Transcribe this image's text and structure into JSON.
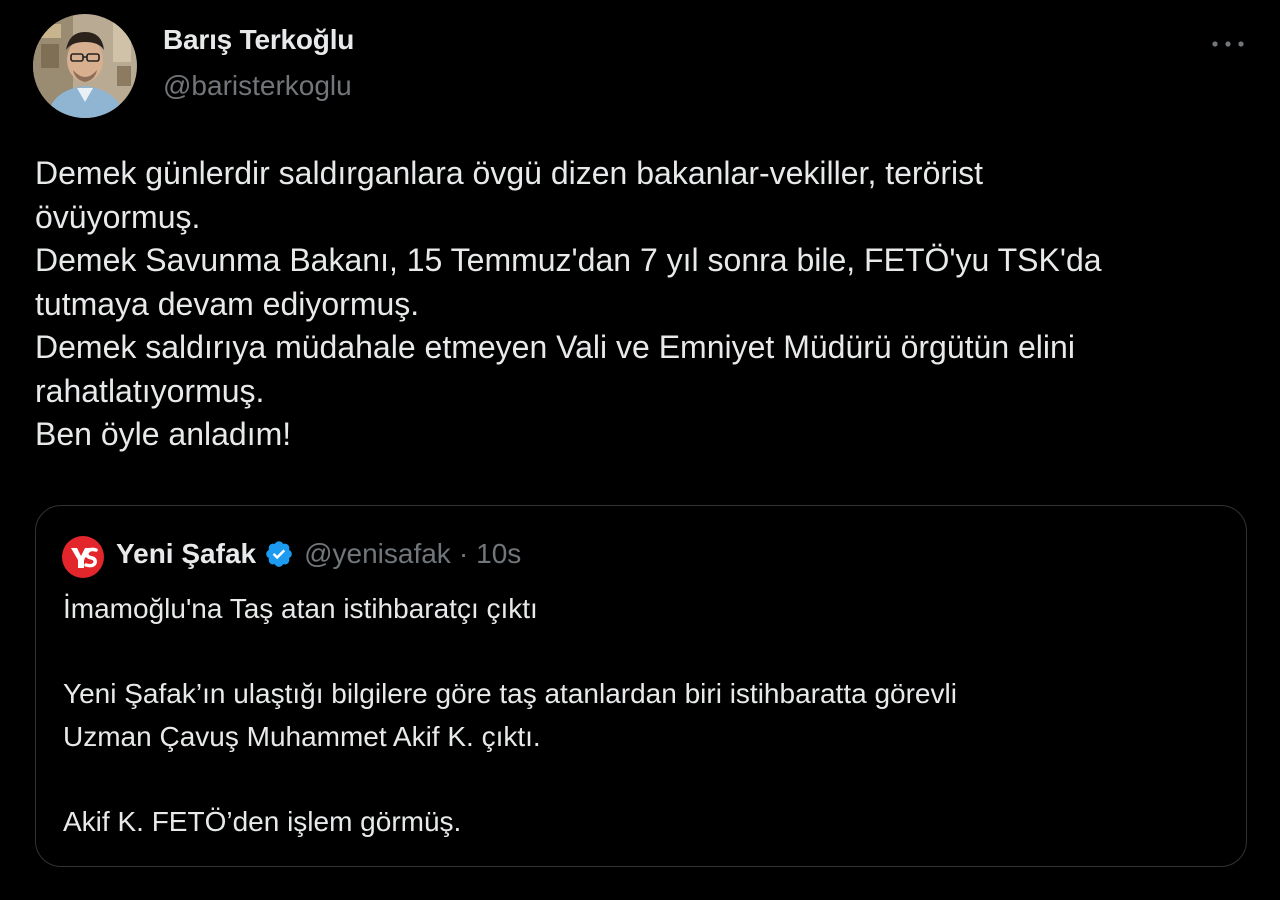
{
  "author": {
    "name": "Barış Terkoğlu",
    "handle": "@baristerkoglu"
  },
  "more_icon": "ellipsis-icon",
  "tweet_lines": [
    "Demek günlerdir saldırganlara övgü dizen bakanlar-vekiller, terörist",
    "övüyormuş.",
    "Demek Savunma Bakanı, 15 Temmuz'dan 7 yıl sonra bile, FETÖ'yu TSK'da",
    "tutmaya devam ediyormuş.",
    "Demek saldırıya müdahale etmeyen Vali ve Emniyet Müdürü örgütün elini",
    "rahatlatıyormuş.",
    "Ben öyle anladım!"
  ],
  "quoted": {
    "name": "Yeni Şafak",
    "verified_icon": "verified-badge-icon",
    "handle": "@yenisafak",
    "separator": "·",
    "time": "10s",
    "lines": [
      "İmamoğlu'na Taş atan istihbaratçı çıktı",
      "",
      "Yeni Şafak’ın ulaştığı bilgilere göre taş atanlardan biri istihbaratta görevli",
      "Uzman Çavuş Muhammet Akif K. çıktı.",
      "",
      "Akif K. FETÖ’den işlem görmüş."
    ]
  },
  "colors": {
    "background": "#000000",
    "text": "#e7e9ea",
    "secondary_text": "#71767b",
    "border": "#2f3336",
    "verified": "#1d9bf0",
    "yenisafak_red": "#e3262c"
  }
}
